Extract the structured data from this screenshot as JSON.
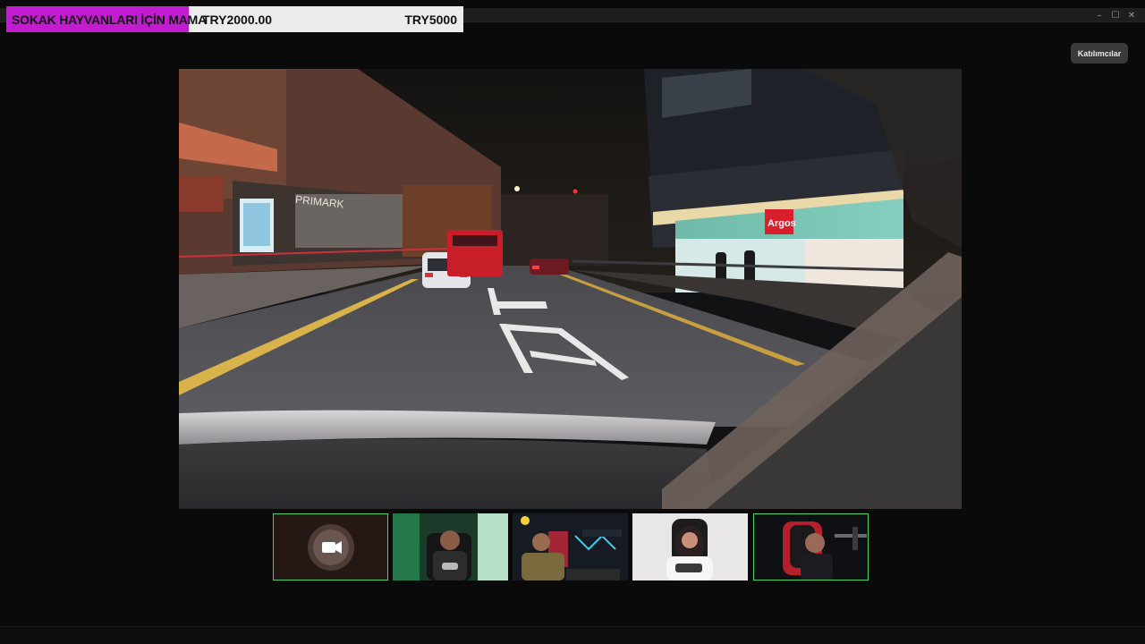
{
  "window": {
    "controls": {
      "minimize": "–",
      "maximize": "☐",
      "close": "✕"
    }
  },
  "donation": {
    "title": "SOKAK HAYVANLARI İÇİN MAMA",
    "current": "TRY2000.00",
    "goal": "TRY5000",
    "progress_fraction": 0.4,
    "fill_color": "#c21bd0"
  },
  "participants_button": {
    "label": "Katılımcılar"
  },
  "main_video": {
    "storefront_signs": {
      "left": "PRIMARK",
      "right": "Argos"
    }
  },
  "thumbnails": [
    {
      "icon": "video-camera-icon",
      "active": true
    },
    {
      "active": false
    },
    {
      "active": false
    },
    {
      "active": false
    },
    {
      "active": true
    }
  ]
}
